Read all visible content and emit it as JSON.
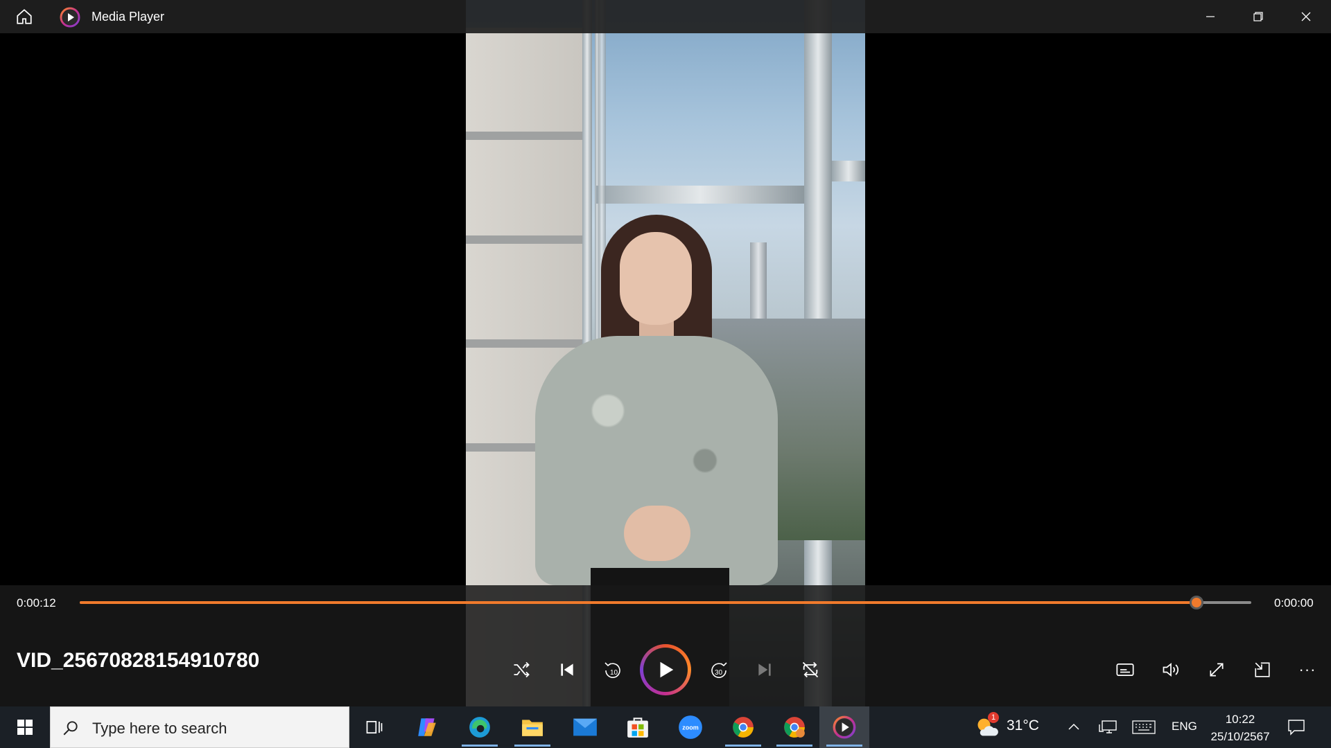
{
  "window": {
    "title": "Media Player",
    "icons": {
      "home": "home-icon",
      "logo": "media-player-logo",
      "minimize": "minimize-icon",
      "restore": "restore-icon",
      "close": "close-icon"
    }
  },
  "player": {
    "elapsed": "0:00:12",
    "remaining": "0:00:00",
    "progress_fraction": 0.953,
    "file_name": "VID_25670828154910780",
    "accent_color": "#f07a2c",
    "controls": [
      "shuffle-icon",
      "previous-icon",
      "skip-back-10-icon",
      "play-icon",
      "skip-forward-30-icon",
      "next-icon",
      "repeat-off-icon"
    ],
    "skip_back_label": "10",
    "skip_forward_label": "30",
    "right_controls": [
      "captions-icon",
      "volume-icon",
      "fullscreen-icon",
      "mini-player-icon",
      "more-icon"
    ],
    "more_label": "···"
  },
  "taskbar": {
    "search_placeholder": "Type here to search",
    "apps": [
      "task-view-icon",
      "copilot-icon",
      "edge-icon",
      "file-explorer-icon",
      "mail-icon",
      "microsoft-store-icon",
      "zoom-icon",
      "chrome-icon",
      "chrome-profile-icon",
      "media-player-icon"
    ],
    "zoom_label": "zoom",
    "weather": {
      "temperature": "31°C",
      "badge": "1"
    },
    "language": "ENG",
    "time": "10:22",
    "date": "25/10/2567"
  }
}
